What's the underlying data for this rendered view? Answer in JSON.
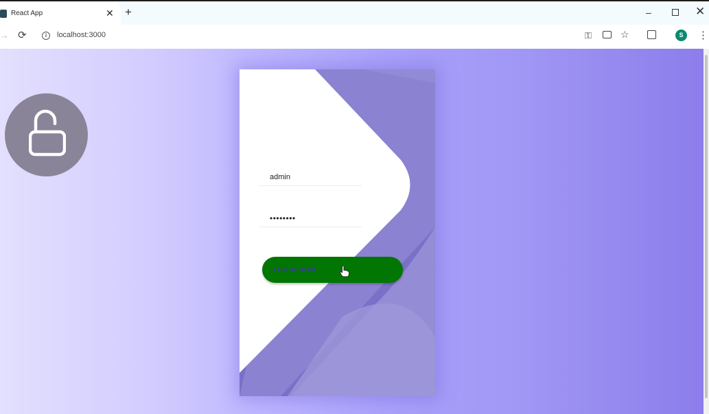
{
  "browser": {
    "tab_title": "React App",
    "tab_close": "✕",
    "new_tab": "+",
    "url": "localhost:3000",
    "profile_initial": "S",
    "window_min": "–",
    "window_close": "✕",
    "reload": "⟳",
    "forward": "→",
    "menu": "⋮",
    "star": "☆",
    "info": "i",
    "key": "⚿"
  },
  "login": {
    "username_value": "admin",
    "password_value": "admin123",
    "button_label": "LOG IN NOW"
  },
  "colors": {
    "button_green": "#027602",
    "card_purple": "#7a70c7",
    "lock_circle": "#8a8499",
    "avatar": "#0d8a6e"
  },
  "icons": [
    "favicon-icon",
    "close-icon",
    "plus-icon",
    "minimize-icon",
    "restore-icon",
    "forward-icon",
    "reload-icon",
    "info-icon",
    "key-icon",
    "install-icon",
    "star-icon",
    "extensions-icon",
    "menu-icon",
    "unlock-icon",
    "hand-cursor-icon"
  ]
}
